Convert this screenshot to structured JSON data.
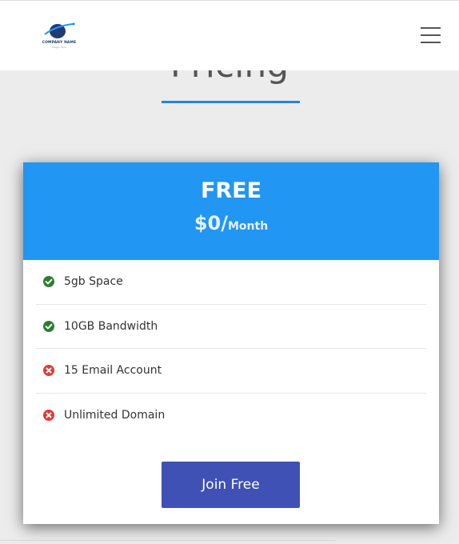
{
  "section": {
    "title": "Pricing"
  },
  "navbar": {
    "logo_name": "COMPANY NAME",
    "logo_tagline": "Slogan Here"
  },
  "plan": {
    "name": "FREE",
    "price": "$0/",
    "period": "Month",
    "features": [
      {
        "label": "5gb Space",
        "included": true,
        "icon": "check-circle-icon"
      },
      {
        "label": "10GB Bandwidth",
        "included": true,
        "icon": "check-circle-icon"
      },
      {
        "label": "15 Email Account",
        "included": false,
        "icon": "x-circle-icon"
      },
      {
        "label": "Unlimited Domain",
        "included": false,
        "icon": "x-circle-icon"
      }
    ],
    "button_label": "Join Free"
  },
  "colors": {
    "accent": "#2196f3",
    "button": "#3f51b5",
    "check": "#2e7d32",
    "cross": "#e53935"
  }
}
